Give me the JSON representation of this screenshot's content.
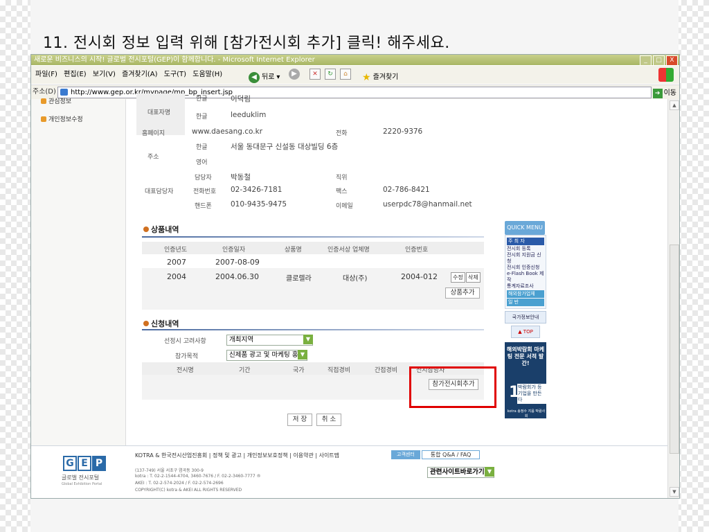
{
  "heading": "11. 전시회 정보 입력 위해 [참가전시회 추가] 클릭! 해주세요.",
  "window": {
    "title": "새로운 비즈니스의 시작! 글로벌 전시포털(GEP)이 함께합니다. - Microsoft Internet Explorer",
    "buttons": [
      "_",
      "□",
      "X"
    ]
  },
  "menu": [
    "파일(F)",
    "편집(E)",
    "보기(V)",
    "즐겨찾기(A)",
    "도구(T)",
    "도움말(H)"
  ],
  "toolbar": {
    "back": "뒤로",
    "favorites": "즐겨찾기"
  },
  "address": {
    "label": "주소(D)",
    "url": "http://www.gep.or.kr/mypage/mp_bp_insert.jsp",
    "go": "이동"
  },
  "sidebar": {
    "items": [
      "관심정보",
      "개인정보수정"
    ]
  },
  "company": {
    "rep_label": "대표자명",
    "rep_kr_label": "한글",
    "rep_kr_val": "이덕림",
    "rep_en_label": "한글",
    "rep_en_val": "leeduklim",
    "home_label": "홈페이지",
    "home_val": "www.daesang.co.kr",
    "tel_label": "전화",
    "tel_val": "2220-9376",
    "addr_label": "주소",
    "addr_kr_label": "한글",
    "addr_kr_val": "서울 동대문구 신설동 대상빌딩 6층",
    "addr_en_label": "영어",
    "contact_label": "대표담당자",
    "c_name_label": "담당자",
    "c_name_val": "박동철",
    "c_title_label": "직위",
    "c_tel_label": "전화번호",
    "c_tel_val": "02-3426-7181",
    "c_fax_label": "팩스",
    "c_fax_val": "02-786-8421",
    "c_hp_label": "핸드폰",
    "c_hp_val": "010-9435-9475",
    "c_mail_label": "이메일",
    "c_mail_val": "userpdc78@hanmail.net"
  },
  "products": {
    "title": "상품내역",
    "headers": [
      "인증년도",
      "인증일자",
      "상품명",
      "인증서상 업체명",
      "인증번호"
    ],
    "rows": [
      {
        "year": "2007",
        "date": "2007-08-09",
        "name": "",
        "company": "",
        "num": ""
      },
      {
        "year": "2004",
        "date": "2004.06.30",
        "name": "클로렐라",
        "company": "대상(주)",
        "num": "2004-012"
      }
    ],
    "edit": "수정",
    "delete": "삭제",
    "add": "상품추가"
  },
  "apply": {
    "title": "신청내역",
    "pref_label": "선정시 고려사항",
    "pref_val": "개최지역",
    "purpose_label": "참가목적",
    "purpose_val": "신제품 광고 및 마케팅 홍보",
    "headers": [
      "전시명",
      "기간",
      "국가",
      "직접경비",
      "간접경비",
      "전시참망사"
    ],
    "add_exhibit": "참가전시회추가",
    "save": "저 장",
    "cancel": "취 소"
  },
  "quick": {
    "title": "QUICK MENU",
    "sub1": "주 최 자",
    "links": [
      "전시회 등록",
      "전시회 지원금 신청",
      "전시회 인증신청",
      "e-Flash Book 제작",
      "통계자료조사"
    ],
    "tag2": "해외참가업체",
    "tag3": "일 반",
    "info": "국가정보안내",
    "top": "▲ TOP",
    "ad_title": "해외박람회 마케팅 전문 서적 발간!",
    "ad_big": "1",
    "ad_text": "박람회가 등기업을 만든다",
    "ad_pub": "kotra 송정수 지음 박람사회"
  },
  "footer": {
    "logo_letters": [
      "G",
      "E",
      "P"
    ],
    "logo_sub": "글로벌 전시포털",
    "logo_sub2": "Global Exhibition Portal",
    "links": "KOTRA & 한국전시산업진흥회 | 정책 및 광고 | 개인정보보호정책 | 이용약관 | 사이트맵",
    "addr1": "(137-749) 서울 서초구 염곡동 300-9",
    "addr2": "kotra : T. 02-2-1544-4704, 3460-7676 / F. 02-2-3460-7777 ®",
    "addr3": "AKEI : T. 02-2-574-2024 / F. 02-2-574-2696",
    "copyright": "COPYRIGHT(C) kotra & AKEI ALL RIGHTS RESERVED",
    "center_label": "고객센터",
    "center_link": "통합 Q&A / FAQ",
    "related": "관련사이트바로가기"
  }
}
